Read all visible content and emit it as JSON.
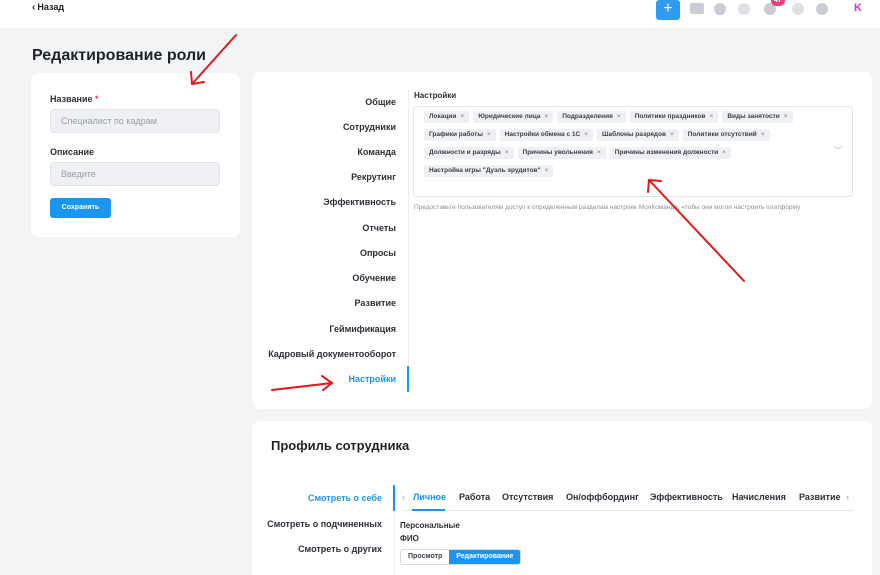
{
  "topbar": {
    "back_label": "Назад",
    "plus_label": "+",
    "notification_count": "47",
    "logo_letter": "K"
  },
  "page_title": "Редактирование роли",
  "form": {
    "name_label": "Название",
    "name_required_mark": "*",
    "name_placeholder": "Специалист по кадрам",
    "desc_label": "Описание",
    "desc_placeholder": "Введите",
    "save_label": "Сохранить"
  },
  "sections": [
    "Общие",
    "Сотрудники",
    "Команда",
    "Рекрутинг",
    "Эффективность",
    "Отчеты",
    "Опросы",
    "Обучение",
    "Развитие",
    "Геймификация",
    "Кадровый документооборот",
    "Настройки"
  ],
  "active_section": "Настройки",
  "settings": {
    "title": "Настройки",
    "tags": [
      "Локации",
      "Юридические лица",
      "Подразделения",
      "Политики праздников",
      "Виды занятости",
      "Графики работы",
      "Настройки обмена с 1С",
      "Шаблоны разрядов",
      "Политики отсутствий",
      "Должности и разряды",
      "Причины увольнения",
      "Причины изменения должности",
      "Настройка игры \"Дуэль эрудитов\""
    ],
    "hint": "Предоставьте пользователям доступ к определенным разделам настроек МояКоманда, чтобы они могли настроить платформу"
  },
  "profile": {
    "title": "Профиль сотрудника",
    "nav": [
      "Смотреть о себе",
      "Смотреть о подчиненных",
      "Смотреть о других"
    ],
    "tabs": [
      "Личное",
      "Работа",
      "Отсутствия",
      "Он/оффбординг",
      "Эффективность",
      "Начисления",
      "Развитие"
    ],
    "section_label": "Персональные",
    "field_label": "ФИО",
    "view_label": "Просмотр",
    "edit_label": "Редактирование"
  },
  "colors": {
    "accent": "#1a96f0",
    "annotation_arrow": "#e01919"
  }
}
